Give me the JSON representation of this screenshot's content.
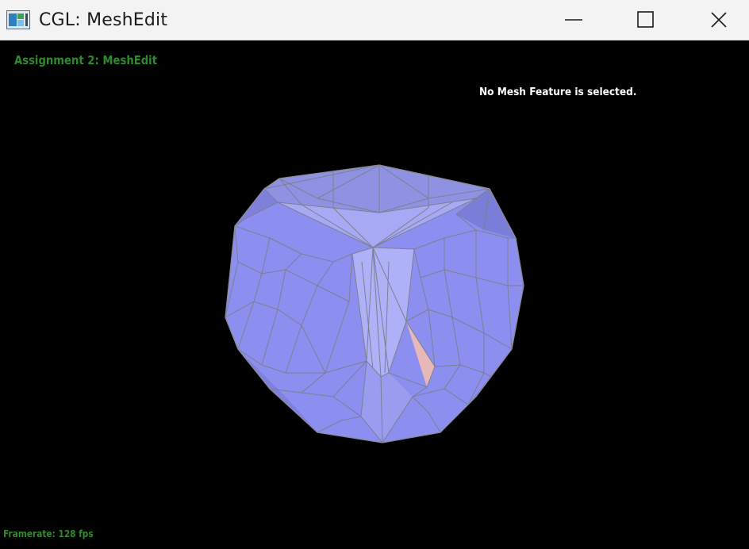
{
  "window": {
    "title": "CGL: MeshEdit",
    "controls": [
      "minimize",
      "maximize",
      "close"
    ]
  },
  "viewport": {
    "assignment_label": "Assignment 2: MeshEdit",
    "selection_status": "No Mesh Feature is selected.",
    "framerate": "Framerate: 128 fps"
  },
  "colors": {
    "background": "#000000",
    "mesh_face": "#9c9ef2",
    "mesh_edge": "#808080",
    "highlight_face": "#e3b8b8",
    "label_green": "#2f8a2c"
  }
}
